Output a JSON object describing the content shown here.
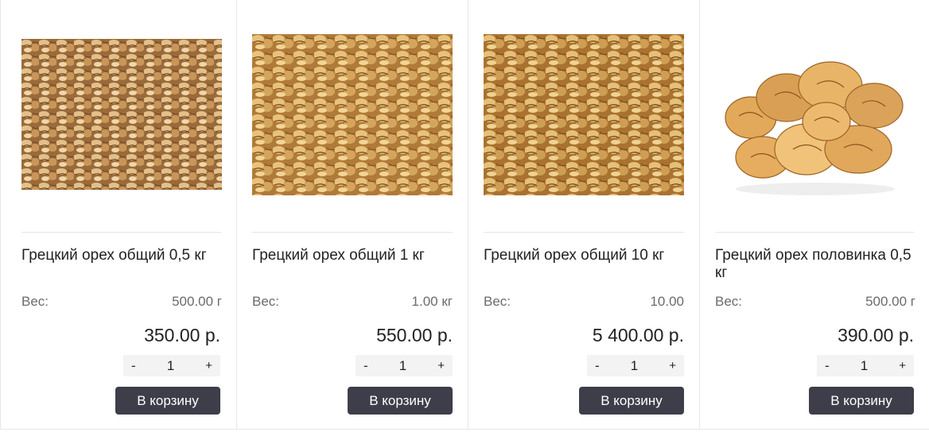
{
  "products": [
    {
      "title": "Грецкий орех общий 0,5 кг",
      "weight_label": "Вес:",
      "weight_value": "500.00 г",
      "price": "350.00 р.",
      "qty_minus": "-",
      "qty_value": "1",
      "qty_plus": "+",
      "button_label": "В корзину",
      "image": "walnut-kernels-photo"
    },
    {
      "title": "Грецкий орех общий 1 кг",
      "weight_label": "Вес:",
      "weight_value": "1.00 кг",
      "price": "550.00 р.",
      "qty_minus": "-",
      "qty_value": "1",
      "qty_plus": "+",
      "button_label": "В корзину",
      "image": "walnut-kernels-photo"
    },
    {
      "title": "Грецкий орех общий 10 кг",
      "weight_label": "Вес:",
      "weight_value": "10.00",
      "price": "5 400.00 р.",
      "qty_minus": "-",
      "qty_value": "1",
      "qty_plus": "+",
      "button_label": "В корзину",
      "image": "walnut-kernels-photo"
    },
    {
      "title": "Грецкий орех половинка 0,5 кг",
      "weight_label": "Вес:",
      "weight_value": "500.00 г",
      "price": "390.00 р.",
      "qty_minus": "-",
      "qty_value": "1",
      "qty_plus": "+",
      "button_label": "В корзину",
      "image": "walnut-halves-photo"
    }
  ],
  "colors": {
    "button_bg": "#3e3e4a",
    "qty_bg": "#f3f3f3",
    "walnut_light": "#d9a866",
    "walnut_dark": "#7a4a1e"
  }
}
